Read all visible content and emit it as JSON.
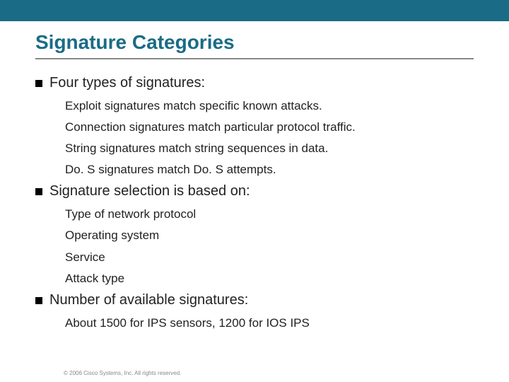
{
  "title": "Signature Categories",
  "sections": [
    {
      "heading": "Four types of signatures:",
      "items": [
        "Exploit signatures match specific known attacks.",
        "Connection signatures match particular protocol traffic.",
        "String signatures match string sequences in data.",
        "Do. S signatures match Do. S attempts."
      ]
    },
    {
      "heading": "Signature selection is based on:",
      "items": [
        "Type of network protocol",
        "Operating system",
        "Service",
        "Attack type"
      ]
    },
    {
      "heading": "Number of available signatures:",
      "items": [
        "About 1500 for IPS sensors, 1200 for IOS IPS"
      ]
    }
  ],
  "footer": "© 2006 Cisco Systems, Inc. All rights reserved."
}
